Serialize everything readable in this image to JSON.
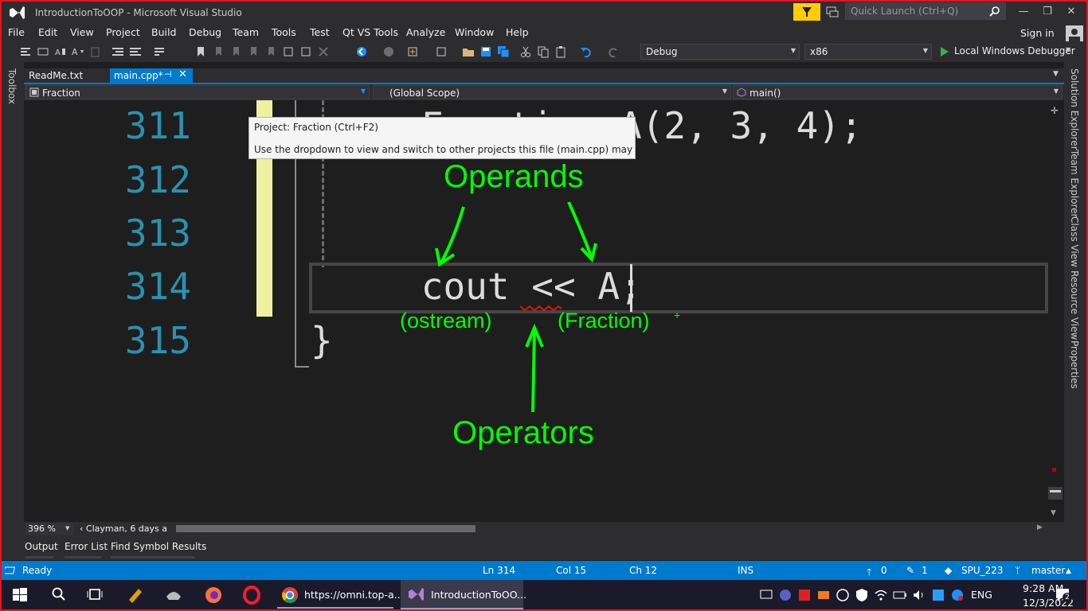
{
  "window": {
    "title": "IntroductionToOOP - Microsoft Visual Studio",
    "quick_launch_placeholder": "Quick Launch (Ctrl+Q)",
    "controls": {
      "minimize": "—",
      "restore": "❐",
      "close": "✕"
    }
  },
  "menu": {
    "items": [
      "File",
      "Edit",
      "View",
      "Project",
      "Build",
      "Debug",
      "Team",
      "Tools",
      "Test",
      "Qt VS Tools",
      "Analyze",
      "Window",
      "Help"
    ],
    "sign_in": "Sign in"
  },
  "toolbar": {
    "configuration": "Debug",
    "platform": "x86",
    "debugger": "Local Windows Debugger"
  },
  "side_panels": {
    "left": [
      "Toolbox"
    ],
    "right": [
      "Solution Explorer",
      "Team Explorer",
      "Class View",
      "Resource View",
      "Properties"
    ]
  },
  "tabs": {
    "readme": "ReadMe.txt",
    "main": "main.cpp*",
    "pin": "⊣",
    "close": "✕"
  },
  "navigation": {
    "project": "Fraction",
    "scope": "(Global Scope)",
    "member": "main()"
  },
  "editor": {
    "lines": [
      {
        "number": "311",
        "code": "    Fraction A(2, 3, 4);"
      },
      {
        "number": "312",
        "code": ""
      },
      {
        "number": "313",
        "code": ""
      },
      {
        "number": "314",
        "code": "    cout << A;"
      },
      {
        "number": "315",
        "code": "}"
      }
    ],
    "tooltip": {
      "title": "Project: Fraction (Ctrl+F2)",
      "body": "Use the dropdown to view and switch to other projects this file (main.cpp) may belong to."
    },
    "annotations": {
      "operands": "Operands",
      "operators": "Operators",
      "ostream": "(ostream)",
      "fraction": "(Fraction)",
      "plus": "+"
    },
    "zoom": "396 %",
    "git_lens": "Clayman, 6 days a"
  },
  "bottom_tabs": [
    "Output",
    "Error List",
    "Find Symbol Results"
  ],
  "status": {
    "state": "Ready",
    "line": "Ln 314",
    "col": "Col 15",
    "ch": "Ch 12",
    "mode": "INS",
    "up_count": "0",
    "edit_count": "1",
    "repo": "SPU_223",
    "branch": "master"
  },
  "taskbar": {
    "chrome_label": "https://omni.top-a...",
    "vs_label": "IntroductionToOO...",
    "language": "ENG",
    "time": "9:28 AM",
    "date": "12/3/2022",
    "notification_count": "2"
  },
  "colors": {
    "accent": "#007acc",
    "line_number": "#2b91af",
    "annotation": "#00ff00",
    "change_bar": "#eff0a0"
  }
}
